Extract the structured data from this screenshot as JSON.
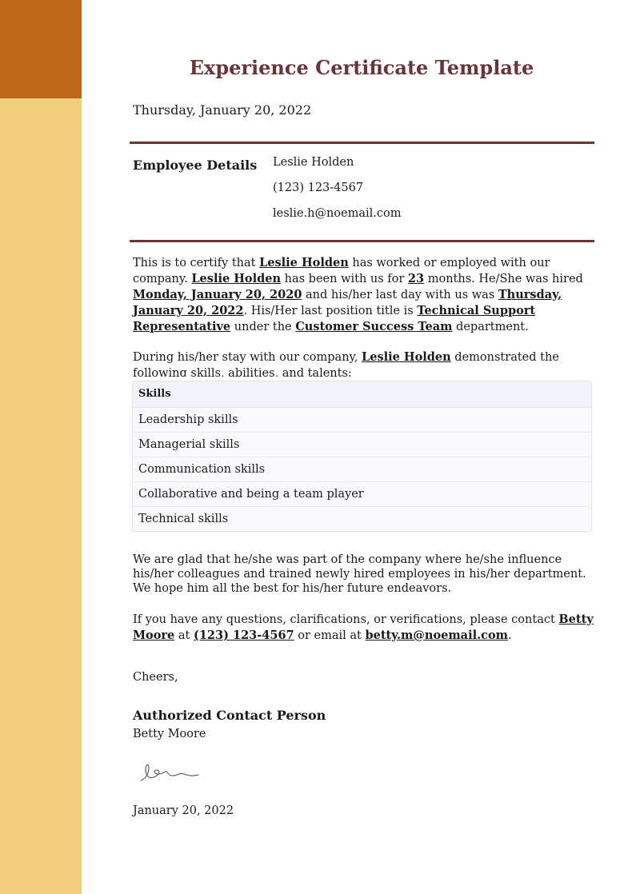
{
  "colors": {
    "sidebar_top": "#bd6718",
    "sidebar": "#f2cf7c",
    "accent": "#6a3537"
  },
  "header": {
    "title": "Experience Certificate Template",
    "date": "Thursday, January 20, 2022"
  },
  "employee": {
    "label": "Employee Details",
    "name": "Leslie Holden",
    "phone": "(123) 123-4567",
    "email": "leslie.h@noemail.com"
  },
  "paragraph1": {
    "t1": "This is to certify that ",
    "name1": "Leslie Holden",
    "t2": " has worked or employed with our company. ",
    "name2": "Leslie Holden",
    "t3": " has been with us for ",
    "months": "23",
    "t4": " months. He/She was hired ",
    "hire_date": "Monday, January 20, 2020",
    "t5": " and his/her last day with us was ",
    "last_date": "Thursday, January 20, 2022",
    "t6": ". His/Her last position title is ",
    "position": "Technical Support Representative",
    "t7": " under the ",
    "department": "Customer Success Team",
    "t8": " department."
  },
  "paragraph2": {
    "t1": "During his/her stay with our company, ",
    "name": "Leslie Holden",
    "t2": " demonstrated the following skills, abilities, and talents:"
  },
  "skills": {
    "header": "Skills",
    "items": [
      "Leadership skills",
      "Managerial skills",
      "Communication skills",
      "Collaborative and being a team player",
      "Technical skills"
    ]
  },
  "paragraph3": "We are glad that he/she was part of the company where he/she influence his/her colleagues and trained newly hired employees in his/her department. We hope him all the best for his/her future endeavors.",
  "paragraph4": {
    "t1": "If you have any questions, clarifications, or verifications, please contact ",
    "contact_name": "Betty Moore",
    "t2": " at ",
    "contact_phone": "(123) 123-4567",
    "t3": " or email at ",
    "contact_email": "betty.m@noemail.com",
    "t4": "."
  },
  "closing": {
    "salutation": "Cheers,",
    "title": "Authorized Contact Person",
    "name": "Betty Moore",
    "signature_icon": "signature-scribble",
    "date": "January 20, 2022"
  }
}
